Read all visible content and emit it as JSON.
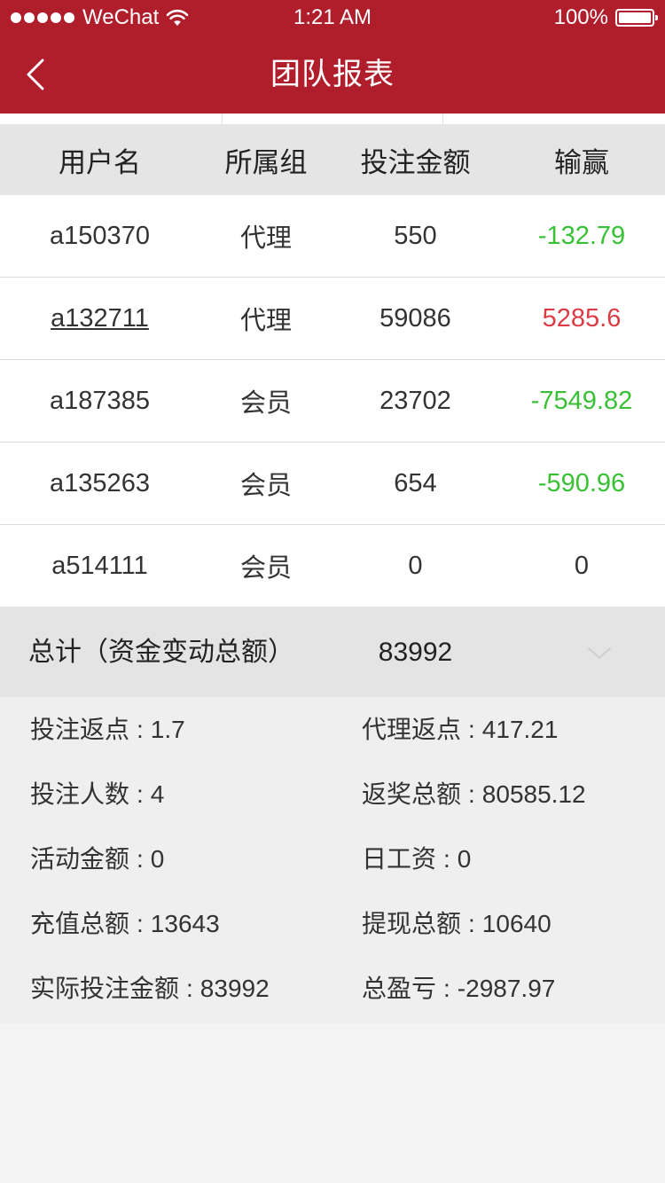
{
  "status_bar": {
    "carrier": "WeChat",
    "time": "1:21 AM",
    "battery": "100%"
  },
  "nav": {
    "title": "团队报表"
  },
  "table": {
    "headers": [
      "用户名",
      "所属组",
      "投注金额",
      "输赢"
    ],
    "rows": [
      {
        "username": "a150370",
        "group": "代理",
        "bet": "550",
        "result": "-132.79"
      },
      {
        "username": "a132711",
        "group": "代理",
        "bet": "59086",
        "result": "5285.6"
      },
      {
        "username": "a187385",
        "group": "会员",
        "bet": "23702",
        "result": "-7549.82"
      },
      {
        "username": "a135263",
        "group": "会员",
        "bet": "654",
        "result": "-590.96"
      },
      {
        "username": "a514111",
        "group": "会员",
        "bet": "0",
        "result": "0"
      }
    ]
  },
  "total": {
    "label": "总计（资金变动总额）",
    "value": "83992"
  },
  "summary": {
    "bet_rebate": {
      "label": "投注返点",
      "value": "1.7"
    },
    "agent_rebate": {
      "label": "代理返点",
      "value": "417.21"
    },
    "bettors": {
      "label": "投注人数",
      "value": "4"
    },
    "payout_total": {
      "label": "返奖总额",
      "value": "80585.12"
    },
    "activity_amount": {
      "label": "活动金额",
      "value": "0"
    },
    "daily_wage": {
      "label": "日工资",
      "value": "0"
    },
    "deposit_total": {
      "label": "充值总额",
      "value": "13643"
    },
    "withdraw_total": {
      "label": "提现总额",
      "value": "10640"
    },
    "actual_bet": {
      "label": "实际投注金额",
      "value": "83992"
    },
    "total_profit": {
      "label": "总盈亏",
      "value": "-2987.97"
    },
    "separator": ":"
  },
  "colors": {
    "brand": "#b01d2b",
    "win": "#dc3b45",
    "loss": "#38c134"
  }
}
